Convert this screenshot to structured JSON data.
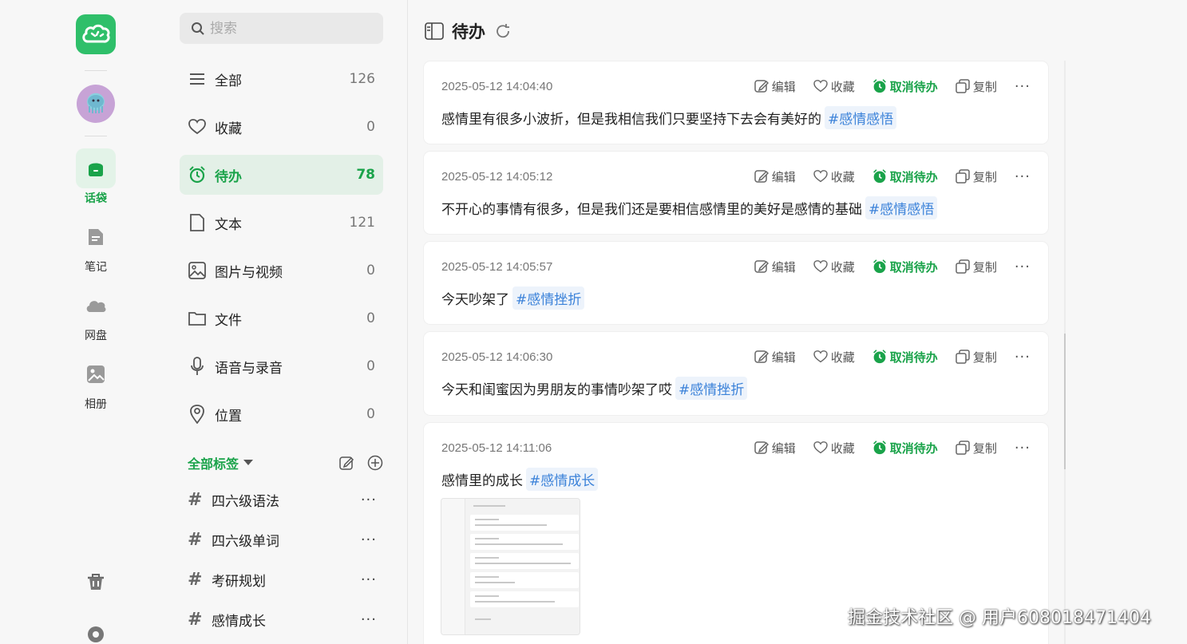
{
  "rail": {
    "items": [
      {
        "label": "话袋",
        "icon": "pouch-icon",
        "active": true
      },
      {
        "label": "笔记",
        "icon": "note-icon",
        "active": false
      },
      {
        "label": "网盘",
        "icon": "cloud-icon",
        "active": false
      },
      {
        "label": "相册",
        "icon": "photo-icon",
        "active": false
      }
    ]
  },
  "search": {
    "placeholder": "搜索"
  },
  "categories": [
    {
      "label": "全部",
      "count": "126"
    },
    {
      "label": "收藏",
      "count": "0"
    },
    {
      "label": "待办",
      "count": "78"
    },
    {
      "label": "文本",
      "count": "121"
    },
    {
      "label": "图片与视频",
      "count": "0"
    },
    {
      "label": "文件",
      "count": "0"
    },
    {
      "label": "语音与录音",
      "count": "0"
    },
    {
      "label": "位置",
      "count": "0"
    }
  ],
  "tags": {
    "title": "全部标签",
    "items": [
      {
        "hash": "#",
        "label": "四六级语法",
        "more": "···"
      },
      {
        "hash": "#",
        "label": "四六级单词",
        "more": "···"
      },
      {
        "hash": "#",
        "label": "考研规划",
        "more": "···"
      },
      {
        "hash": "#",
        "label": "感情成长",
        "more": "···"
      }
    ]
  },
  "main": {
    "title": "待办",
    "actions": {
      "edit": "编辑",
      "fav": "收藏",
      "todo": "取消待办",
      "copy": "复制",
      "more": "···"
    },
    "cards": [
      {
        "time": "2025-05-12 14:04:40",
        "text": "感情里有很多小波折，但是我相信我们只要坚持下去会有美好的",
        "tag": "#感情感悟"
      },
      {
        "time": "2025-05-12 14:05:12",
        "text": "不开心的事情有很多，但是我们还是要相信感情里的美好是感情的基础",
        "tag": "#感情感悟"
      },
      {
        "time": "2025-05-12 14:05:57",
        "text": "今天吵架了",
        "tag": "#感情挫折"
      },
      {
        "time": "2025-05-12 14:06:30",
        "text": "今天和闺蜜因为男朋友的事情吵架了哎",
        "tag": "#感情挫折"
      },
      {
        "time": "2025-05-12 14:11:06",
        "text": "感情里的成长",
        "tag": "#感情成长"
      }
    ]
  },
  "watermark": "掘金技术社区 @ 用户608018471404",
  "colors": {
    "accent": "#1aa34a",
    "brand": "#2fbf6a",
    "tag_text": "#3b82d9",
    "tag_bg": "#edf3fb"
  }
}
